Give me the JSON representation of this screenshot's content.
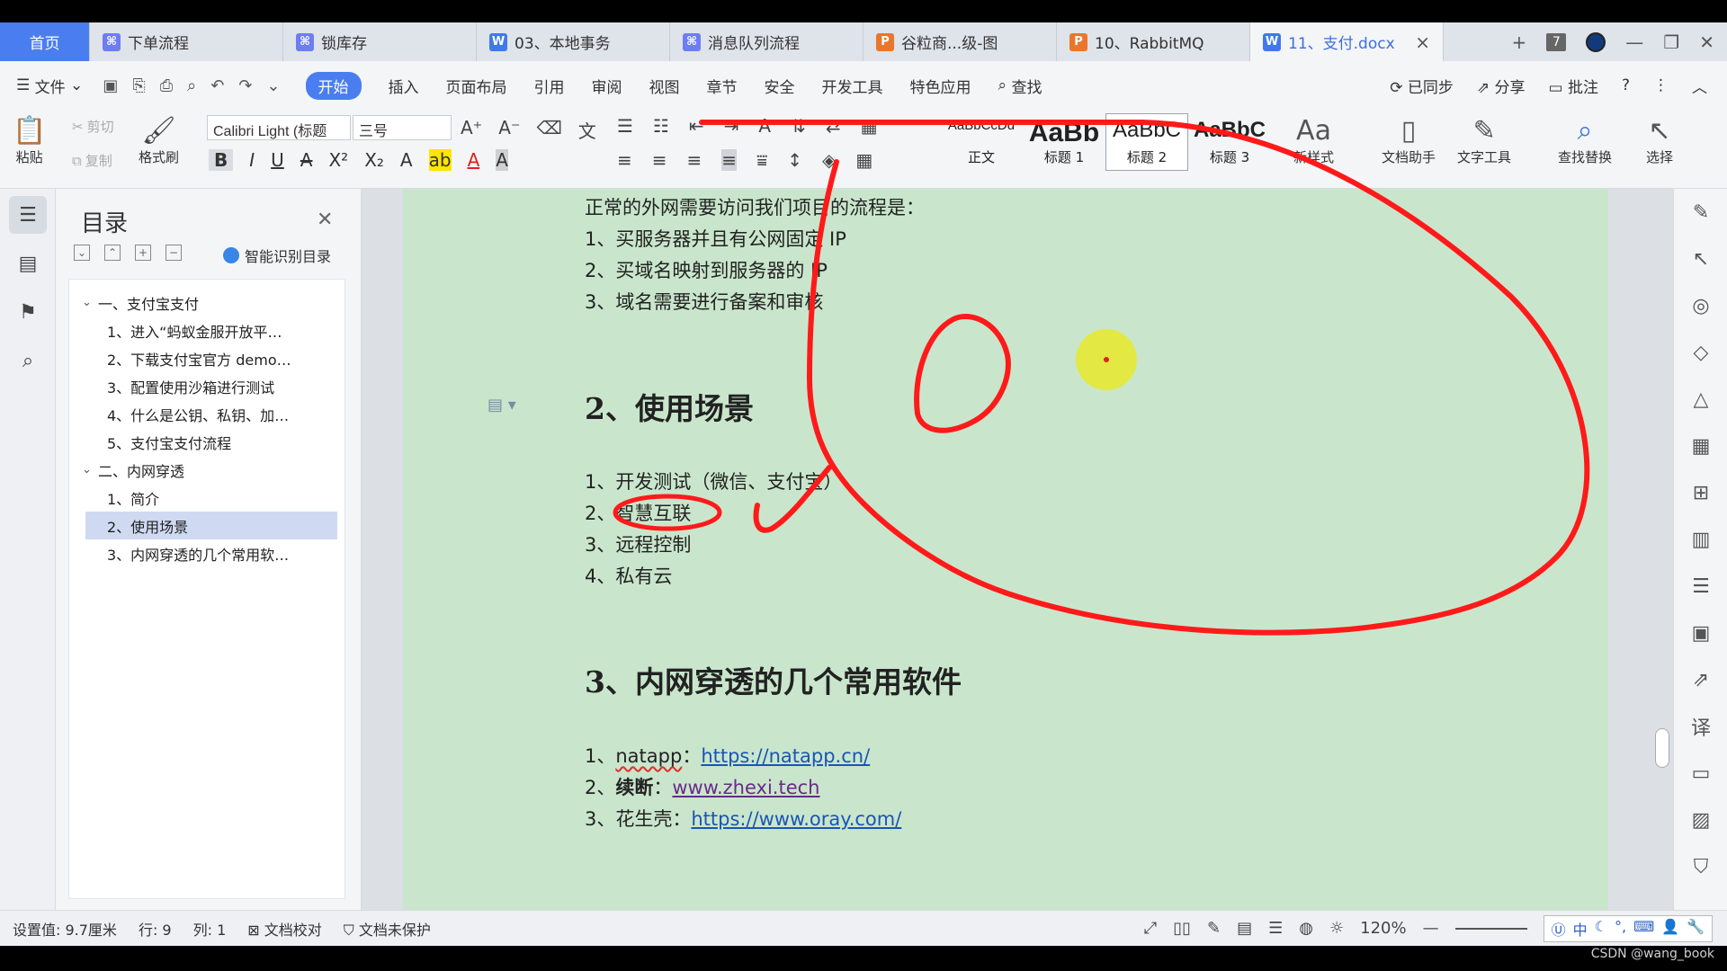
{
  "tabs": [
    {
      "label": "首页",
      "type": "home"
    },
    {
      "label": "下单流程",
      "type": "flow"
    },
    {
      "label": "锁库存",
      "type": "flow"
    },
    {
      "label": "03、本地事务",
      "type": "word"
    },
    {
      "label": "消息队列流程",
      "type": "flow"
    },
    {
      "label": "谷粒商...级-图",
      "type": "ppt"
    },
    {
      "label": "10、RabbitMQ",
      "type": "ppt"
    },
    {
      "label": "11、支付.docx",
      "type": "word"
    }
  ],
  "tabbar": {
    "add": "+",
    "count": "7",
    "close": "×"
  },
  "menu": {
    "file": "文件",
    "items": [
      "开始",
      "插入",
      "页面布局",
      "引用",
      "审阅",
      "视图",
      "章节",
      "安全",
      "开发工具",
      "特色应用"
    ],
    "search": "查找",
    "sync": "已同步",
    "share": "分享",
    "comment": "批注",
    "help": "?"
  },
  "ribbon": {
    "paste": "粘贴",
    "cut": "剪切",
    "copy": "复制",
    "format_painter": "格式刷",
    "font_name": "Calibri Light (标题",
    "font_size": "三号",
    "styles": [
      {
        "preview": "AaBbCcDd",
        "name": "正文"
      },
      {
        "preview": "AaBb",
        "name": "标题 1"
      },
      {
        "preview": "AaBbC",
        "name": "标题 2"
      },
      {
        "preview": "AaBbC",
        "name": "标题 3"
      }
    ],
    "new_style": "新样式",
    "doc_assistant": "文档助手",
    "text_tools": "文字工具",
    "find_replace": "查找替换",
    "select": "选择"
  },
  "toc": {
    "title": "目录",
    "smart": "智能识别目录",
    "items": [
      {
        "level": 1,
        "label": "一、支付宝支付"
      },
      {
        "level": 2,
        "label": "1、进入“蚂蚁金服开放平…"
      },
      {
        "level": 2,
        "label": "2、下载支付宝官方 demo…"
      },
      {
        "level": 2,
        "label": "3、配置使用沙箱进行测试"
      },
      {
        "level": 2,
        "label": "4、什么是公钥、私钥、加…"
      },
      {
        "level": 2,
        "label": "5、支付宝支付流程"
      },
      {
        "level": 1,
        "label": "二、内网穿透"
      },
      {
        "level": 2,
        "label": "1、简介"
      },
      {
        "level": 2,
        "label": "2、使用场景",
        "selected": true
      },
      {
        "level": 2,
        "label": "3、内网穿透的几个常用软…"
      }
    ]
  },
  "document": {
    "intro": "正常的外网需要访问我们项目的流程是：",
    "intro_items": [
      "1、买服务器并且有公网固定 IP",
      "2、买域名映射到服务器的 IP",
      "3、域名需要进行备案和审核"
    ],
    "h2": "2、使用场景",
    "scenes": [
      "1、开发测试（微信、支付宝）",
      "2、智慧互联",
      "3、远程控制",
      "4、私有云"
    ],
    "h3": "3、内网穿透的几个常用软件",
    "tools": [
      {
        "prefix": "1、",
        "name": "natapp",
        "sep": "：",
        "link": "https://natapp.cn/"
      },
      {
        "prefix": "2、",
        "name": "续断",
        "sep": "：",
        "link": "www.zhexi.tech"
      },
      {
        "prefix": "3、",
        "name": "花生壳",
        "sep": "：",
        "link": "https://www.oray.com/"
      }
    ]
  },
  "status": {
    "setting": "设置值: 9.7厘米",
    "row": "行: 9",
    "col": "列: 1",
    "proof": "文档校对",
    "protect": "文档未保护",
    "zoom": "120%",
    "ime": "中"
  },
  "watermark": "CSDN @wang_book",
  "colors": {
    "accent": "#4a7ef0",
    "page_bg": "#c9e6cc",
    "annotation": "#ff1a1a",
    "pointer": "#e8e82a"
  }
}
